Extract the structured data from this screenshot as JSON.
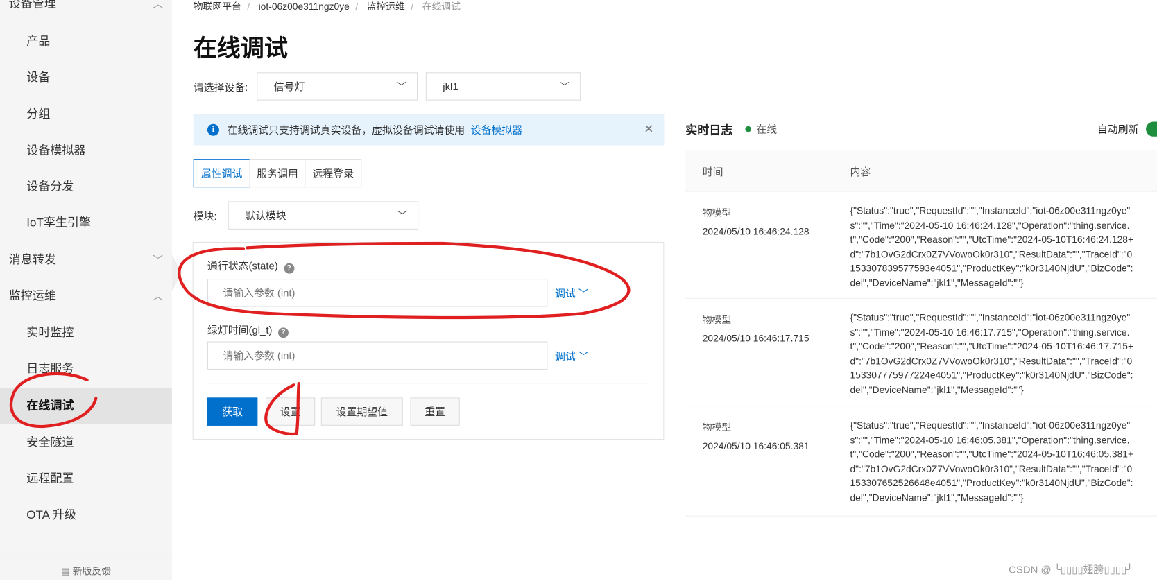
{
  "sidebar": {
    "items": [
      {
        "label": "设备管理",
        "section": true,
        "chevron": "chevron-up-icon"
      },
      {
        "label": "产品"
      },
      {
        "label": "设备"
      },
      {
        "label": "分组"
      },
      {
        "label": "设备模拟器"
      },
      {
        "label": "设备分发"
      },
      {
        "label": "IoT孪生引擎"
      },
      {
        "label": "消息转发",
        "section": true,
        "chevron": "chevron-down-icon"
      },
      {
        "label": "监控运维",
        "section": true,
        "chevron": "chevron-up-icon"
      },
      {
        "label": "实时监控"
      },
      {
        "label": "日志服务"
      },
      {
        "label": "在线调试",
        "active": true
      },
      {
        "label": "安全隧道"
      },
      {
        "label": "远程配置"
      },
      {
        "label": "OTA 升级"
      }
    ],
    "feedback": "新版反馈"
  },
  "breadcrumb": [
    "物联网平台",
    "iot-06z00e311ngz0ye",
    "监控运维",
    "在线调试"
  ],
  "page_title": "在线调试",
  "device_select": {
    "label": "请选择设备:",
    "product": "信号灯",
    "device": "jkl1"
  },
  "alert": {
    "text": "在线调试只支持调试真实设备，虚拟设备调试请使用",
    "link": "设备模拟器"
  },
  "tabs": [
    {
      "label": "属性调试",
      "active": true
    },
    {
      "label": "服务调用"
    },
    {
      "label": "远程登录"
    }
  ],
  "module": {
    "label": "模块:",
    "value": "默认模块"
  },
  "fields": [
    {
      "label": "通行状态(state)",
      "placeholder": "请输入参数 (int)",
      "action": "调试"
    },
    {
      "label": "绿灯时间(gl_t)",
      "placeholder": "请输入参数 (int)",
      "action": "调试"
    }
  ],
  "buttons": {
    "get": "获取",
    "set": "设置",
    "set_expected": "设置期望值",
    "reset": "重置"
  },
  "log": {
    "title": "实时日志",
    "status": "在线",
    "auto_refresh": "自动刷新",
    "auto_refresh_on": true,
    "columns": [
      "时间",
      "内容"
    ],
    "rows": [
      {
        "type": "物模型",
        "time": "2024/05/10 16:46:24.128",
        "lines": [
          "{\"Status\":\"true\",\"RequestId\":\"\",\"InstanceId\":\"iot-06z00e311ngz0ye\"",
          "s\":\"\",\"Time\":\"2024-05-10 16:46:24.128\",\"Operation\":\"thing.service.",
          "t\",\"Code\":\"200\",\"Reason\":\"\",\"UtcTime\":\"2024-05-10T16:46:24.128+",
          "d\":\"7b1OvG2dCrx0Z7VVowoOk0r310\",\"ResultData\":\"\",\"TraceId\":\"0",
          "153307839577593e4051\",\"ProductKey\":\"k0r3140NjdU\",\"BizCode\":",
          "del\",\"DeviceName\":\"jkl1\",\"MessageId\":\"\"}"
        ]
      },
      {
        "type": "物模型",
        "time": "2024/05/10 16:46:17.715",
        "lines": [
          "{\"Status\":\"true\",\"RequestId\":\"\",\"InstanceId\":\"iot-06z00e311ngz0ye\"",
          "s\":\"\",\"Time\":\"2024-05-10 16:46:17.715\",\"Operation\":\"thing.service.",
          "t\",\"Code\":\"200\",\"Reason\":\"\",\"UtcTime\":\"2024-05-10T16:46:17.715+",
          "d\":\"7b1OvG2dCrx0Z7VVowoOk0r310\",\"ResultData\":\"\",\"TraceId\":\"0",
          "153307775977224e4051\",\"ProductKey\":\"k0r3140NjdU\",\"BizCode\":",
          "del\",\"DeviceName\":\"jkl1\",\"MessageId\":\"\"}"
        ]
      },
      {
        "type": "物模型",
        "time": "2024/05/10 16:46:05.381",
        "lines": [
          "{\"Status\":\"true\",\"RequestId\":\"\",\"InstanceId\":\"iot-06z00e311ngz0ye\"",
          "s\":\"\",\"Time\":\"2024-05-10 16:46:05.381\",\"Operation\":\"thing.service.",
          "t\",\"Code\":\"200\",\"Reason\":\"\",\"UtcTime\":\"2024-05-10T16:46:05.381+",
          "d\":\"7b1OvG2dCrx0Z7VVowoOk0r310\",\"ResultData\":\"\",\"TraceId\":\"0",
          "153307652526648e4051\",\"ProductKey\":\"k0r3140NjdU\",\"BizCode\":",
          "del\",\"DeviceName\":\"jkl1\",\"MessageId\":\"\"}"
        ]
      }
    ]
  },
  "watermark": "CSDN @ ╰▯▯▯▯翅膀▯▯▯▯╯",
  "colors": {
    "primary": "#0070cc",
    "online": "#1e8e3e",
    "annotation": "#e02020",
    "alert_bg": "#e6f3fd"
  }
}
